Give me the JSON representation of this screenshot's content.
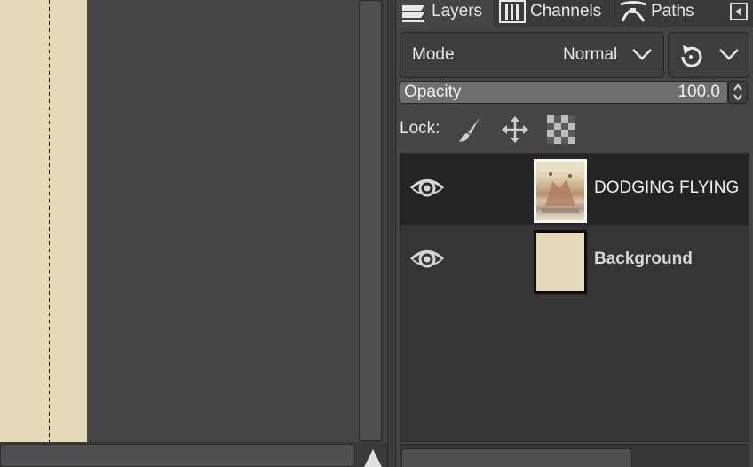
{
  "canvas": {
    "image_background_color": "#e6dabb",
    "layer_boundary_style": "dashed"
  },
  "dock": {
    "tabs": [
      {
        "label": "Layers",
        "icon": "layers-icon",
        "active": true
      },
      {
        "label": "Channels",
        "icon": "channels-icon",
        "active": false
      },
      {
        "label": "Paths",
        "icon": "paths-icon",
        "active": false
      }
    ],
    "menu_icon": "dock-menu-icon"
  },
  "mode": {
    "label": "Mode",
    "value": "Normal"
  },
  "opacity": {
    "label": "Opacity",
    "value": "100.0"
  },
  "lock": {
    "label": "Lock:",
    "buttons": [
      "lock-pixels-icon",
      "lock-position-icon",
      "lock-alpha-icon"
    ]
  },
  "layers": [
    {
      "name": "DODGING FLYING",
      "visible": true,
      "selected": true
    },
    {
      "name": "Background",
      "visible": true,
      "selected": false,
      "thumb_color": "#e6dabb"
    }
  ],
  "colors": {
    "panel_bg": "#454545",
    "list_bg": "#353535",
    "selected_row": "#242424",
    "canvas_image": "#e6dabb"
  }
}
